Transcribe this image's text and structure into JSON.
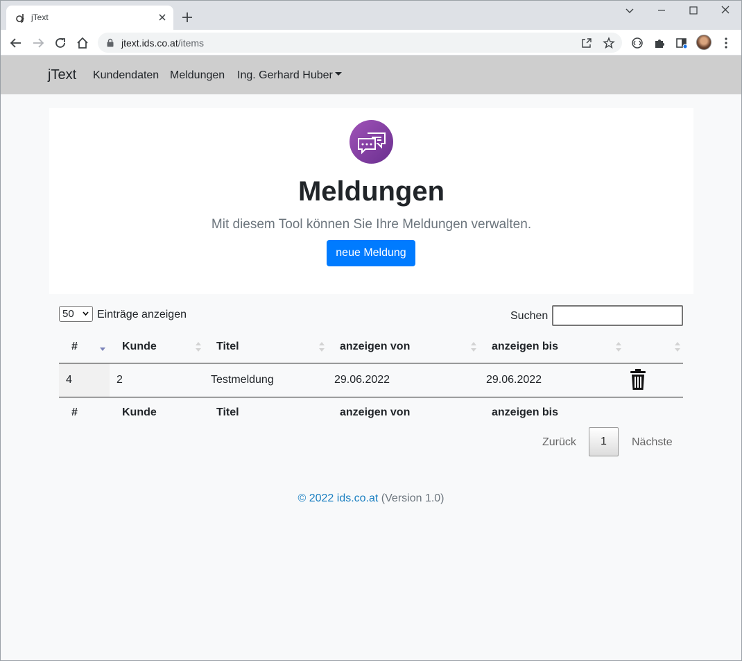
{
  "browser": {
    "tab_title": "jText",
    "url_host": "jtext.ids.co.at",
    "url_path": "/items"
  },
  "navbar": {
    "brand": "jText",
    "links": [
      "Kundendaten",
      "Meldungen"
    ],
    "user_menu": "Ing. Gerhard Huber"
  },
  "jumbotron": {
    "icon": "chat-bubbles-icon",
    "title": "Meldungen",
    "lead": "Mit diesem Tool können Sie Ihre Meldungen verwalten.",
    "button": "neue Meldung"
  },
  "table_controls": {
    "page_length": "50",
    "page_length_label": "Einträge anzeigen",
    "search_label": "Suchen",
    "search_value": ""
  },
  "table": {
    "columns": [
      "#",
      "Kunde",
      "Titel",
      "anzeigen von",
      "anzeigen bis",
      ""
    ],
    "rows": [
      {
        "id": "4",
        "kunde": "2",
        "titel": "Testmeldung",
        "von": "29.06.2022",
        "bis": "29.06.2022",
        "action_icon": "trash-icon"
      }
    ],
    "footer_columns": [
      "#",
      "Kunde",
      "Titel",
      "anzeigen von",
      "anzeigen bis"
    ]
  },
  "pagination": {
    "prev": "Zurück",
    "current": "1",
    "next": "Nächste"
  },
  "footer": {
    "copyright": "© 2022 ids.co.at",
    "version": "(Version 1.0)"
  },
  "colors": {
    "navbar": "#cecece",
    "primary": "#007bff",
    "icon_purple": "#8a44a8",
    "footer_link": "#1a7fc1"
  }
}
